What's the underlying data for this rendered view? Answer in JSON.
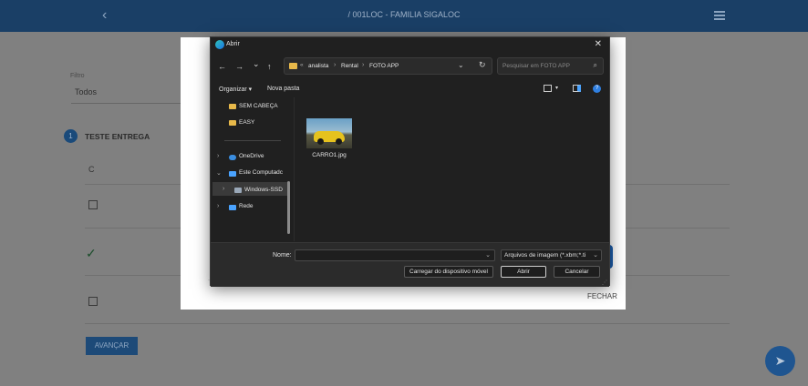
{
  "app": {
    "back_icon": "chevron-left-icon",
    "title": "/ 001LOC - FAMILIA SIGALOC",
    "menu_icon": "hamburger-menu-icon",
    "header_color": "#1a3f66"
  },
  "filter": {
    "label": "Filtro",
    "value": "Todos"
  },
  "step": {
    "number": "1",
    "label": "TESTE ENTREGA"
  },
  "rows": [
    {
      "type": "text",
      "value": "C"
    },
    {
      "type": "checkbox",
      "checked": false
    },
    {
      "type": "check",
      "checked": true
    },
    {
      "type": "checkbox",
      "checked": false
    }
  ],
  "buttons": {
    "avancar": "AVANÇAR",
    "send_icon": "send-icon",
    "fechar": "FECHAR"
  },
  "dialog": {
    "title": "Abrir",
    "close_icon": "close-icon",
    "nav": {
      "back": "←",
      "forward": "→",
      "recent": "⌄",
      "up": "↑"
    },
    "address": {
      "crumbs": [
        "analista",
        "Rental",
        "FOTO APP"
      ],
      "dots": "«",
      "separator": "›",
      "dropdown": "⌄",
      "refresh": "↻"
    },
    "search_placeholder": "Pesquisar em FOTO APP",
    "toolbar": {
      "organizar": "Organizar ▾",
      "nova_pasta": "Nova pasta"
    },
    "sidebar": {
      "quick": [
        "SEM CABEÇA",
        "EASY"
      ],
      "onedrive": "OneDrive",
      "este_computador": "Este Computadc",
      "windows_ssd": "Windows-SSD",
      "rede": "Rede"
    },
    "files": [
      {
        "name": "CARRO1.jpg"
      }
    ],
    "footer": {
      "nome_label": "Nome:",
      "nome_value": "",
      "filetype": "Arquivos de imagem (*.xbm;*.ti",
      "carregar": "Carregar do dispositivo móvel",
      "abrir": "Abrir",
      "cancelar": "Cancelar"
    }
  },
  "colors": {
    "accent": "#1d5fae",
    "dialog_bg": "#202020",
    "folder": "#e8b94a"
  }
}
